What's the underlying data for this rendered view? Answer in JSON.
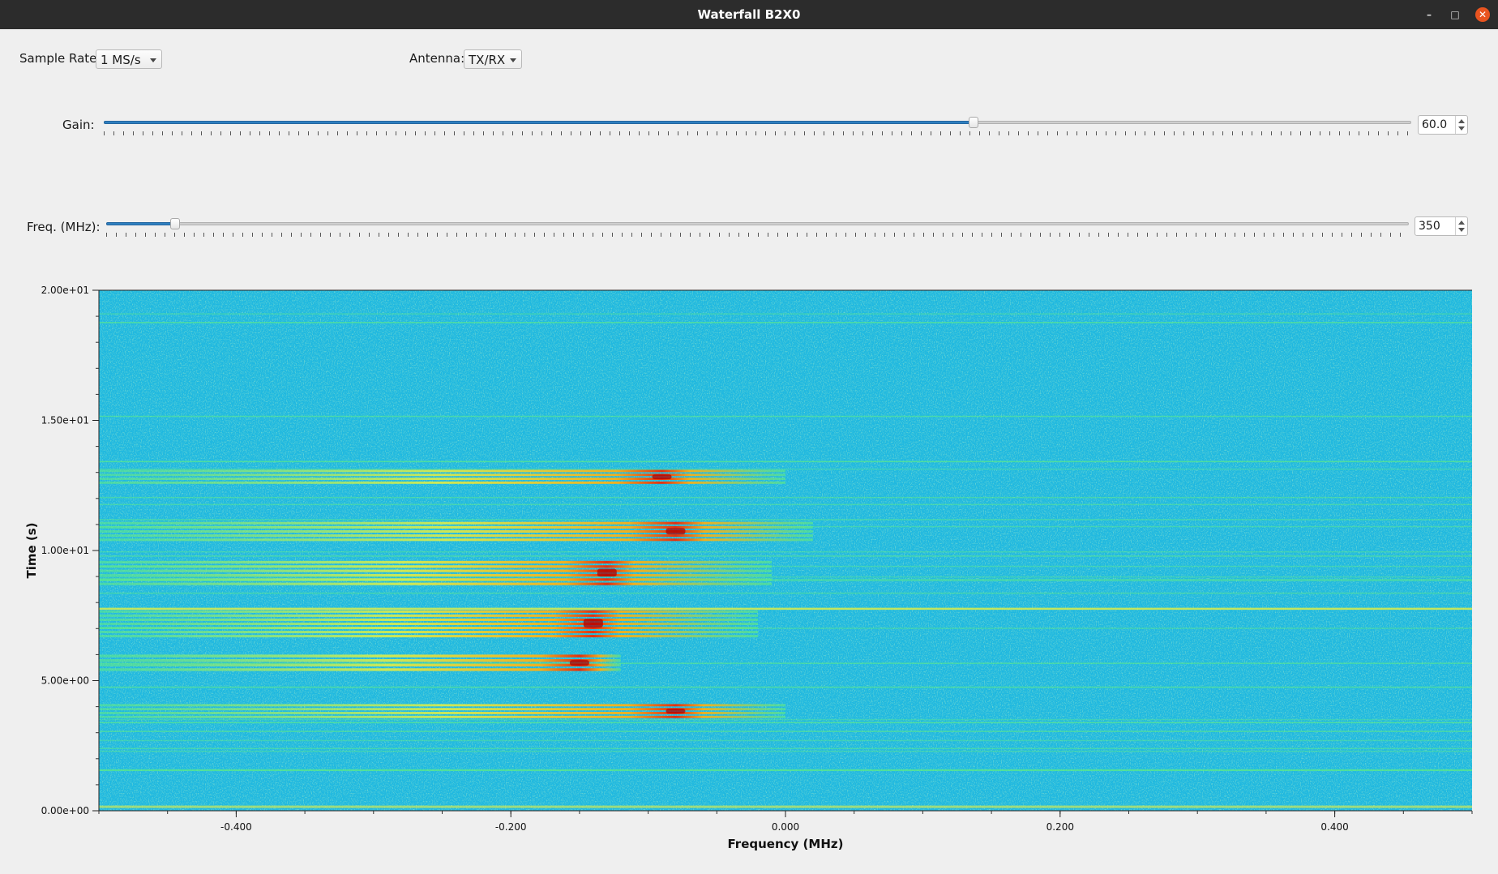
{
  "window": {
    "title": "Waterfall B2X0"
  },
  "controls": {
    "sample_rate_label": "Sample Rate:",
    "sample_rate_value": "1 MS/s",
    "antenna_label": "Antenna:",
    "antenna_value": "TX/RX",
    "gain_label": "Gain:",
    "gain_value": "60.0",
    "gain_fraction": 0.665,
    "freq_label": "Freq. (MHz):",
    "freq_value": "350",
    "freq_fraction": 0.053
  },
  "chart_data": {
    "type": "heatmap",
    "xlabel": "Frequency (MHz)",
    "ylabel": "Time (s)",
    "xlim": [
      -0.5,
      0.5
    ],
    "ylim": [
      0,
      20
    ],
    "x_ticks": [
      -0.4,
      -0.2,
      0.0,
      0.2,
      0.4
    ],
    "x_tick_labels": [
      "-0.400",
      "-0.200",
      "0.000",
      "0.200",
      "0.400"
    ],
    "y_ticks": [
      0,
      5,
      10,
      15,
      20
    ],
    "y_tick_labels": [
      "0.00e+00",
      "5.00e+00",
      "1.00e+01",
      "1.50e+01",
      "2.00e+01"
    ],
    "colormap": [
      "#1fb8e0",
      "#2fe0d0",
      "#60ee80",
      "#e8f040",
      "#f0b020",
      "#e03010",
      "#b00000"
    ],
    "signal_bursts": [
      {
        "t_start": 3.5,
        "t_end": 4.1,
        "f_start": -0.5,
        "f_end": 0.0,
        "peak_freq": -0.08
      },
      {
        "t_start": 5.3,
        "t_end": 6.0,
        "f_start": -0.5,
        "f_end": -0.12,
        "peak_freq": -0.15
      },
      {
        "t_start": 6.6,
        "t_end": 7.7,
        "f_start": -0.5,
        "f_end": -0.02,
        "peak_freq": -0.14
      },
      {
        "t_start": 8.6,
        "t_end": 9.6,
        "f_start": -0.5,
        "f_end": -0.01,
        "peak_freq": -0.13
      },
      {
        "t_start": 10.3,
        "t_end": 11.1,
        "f_start": -0.5,
        "f_end": 0.02,
        "peak_freq": -0.08
      },
      {
        "t_start": 12.5,
        "t_end": 13.1,
        "f_start": -0.5,
        "f_end": 0.0,
        "peak_freq": -0.09
      }
    ]
  }
}
